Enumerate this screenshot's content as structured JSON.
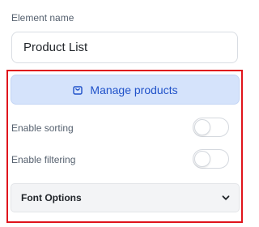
{
  "element_name": {
    "label": "Element name",
    "value": "Product List"
  },
  "manage_button": {
    "label": "Manage products",
    "icon": "shopping-bag-icon"
  },
  "settings": [
    {
      "label": "Enable sorting",
      "enabled": false
    },
    {
      "label": "Enable filtering",
      "enabled": false
    }
  ],
  "font_options": {
    "label": "Font Options",
    "icon": "chevron-down-icon"
  },
  "colors": {
    "accent": "#2052c9",
    "button_bg": "#d5e3fb",
    "highlight": "#e0141c"
  }
}
